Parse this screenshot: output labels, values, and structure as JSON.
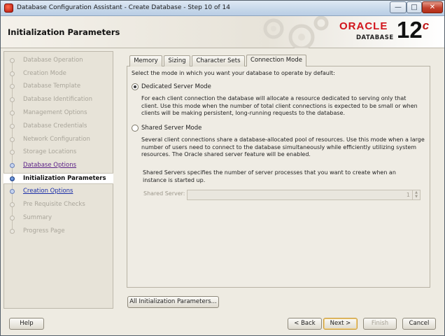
{
  "window": {
    "title": "Database Configuration Assistant - Create Database - Step 10 of 14",
    "min_glyph": "—",
    "max_glyph": "□",
    "close_glyph": "✕"
  },
  "header": {
    "page_title": "Initialization Parameters",
    "brand": "ORACLE",
    "brand_sub": "DATABASE",
    "version": "12",
    "version_sup": "c",
    "accent": "#d2131a"
  },
  "nav": {
    "items": [
      {
        "label": "Database Operation",
        "state": "done"
      },
      {
        "label": "Creation Mode",
        "state": "done"
      },
      {
        "label": "Database Template",
        "state": "done"
      },
      {
        "label": "Database Identification",
        "state": "done"
      },
      {
        "label": "Management Options",
        "state": "done"
      },
      {
        "label": "Database Credentials",
        "state": "done"
      },
      {
        "label": "Network Configuration",
        "state": "done"
      },
      {
        "label": "Storage Locations",
        "state": "done"
      },
      {
        "label": "Database Options",
        "state": "visited"
      },
      {
        "label": "Initialization Parameters",
        "state": "current"
      },
      {
        "label": "Creation Options",
        "state": "link"
      },
      {
        "label": "Pre Requisite Checks",
        "state": "pending"
      },
      {
        "label": "Summary",
        "state": "pending"
      },
      {
        "label": "Progress Page",
        "state": "pending"
      }
    ]
  },
  "tabs": [
    {
      "label": "Memory",
      "active": false
    },
    {
      "label": "Sizing",
      "active": false
    },
    {
      "label": "Character Sets",
      "active": false
    },
    {
      "label": "Connection Mode",
      "active": true
    }
  ],
  "connection_mode": {
    "intro": "Select the mode in which you want your database to operate by default:",
    "dedicated": {
      "label": "Dedicated Server Mode",
      "selected": true,
      "description": "For each client connection the database will allocate a resource dedicated to serving only that client.  Use this mode when the number of total client connections is expected to be small or when clients will be making persistent, long-running requests to the database."
    },
    "shared": {
      "label": "Shared Server Mode",
      "selected": false,
      "description": "Several client connections share a database-allocated pool of resources.  Use this mode when a large number of users need to connect to the database simultaneously while efficiently utilizing system resources.  The Oracle shared server feature will be enabled.",
      "servers_note": "Shared Servers specifies the number of server processes that you want to create when an instance is started up.",
      "servers_label": "Shared Server:",
      "servers_value": "1"
    }
  },
  "buttons": {
    "all_params": "All Initialization Parameters...",
    "help": "Help",
    "back": "< Back",
    "next": "Next >",
    "finish": "Finish",
    "cancel": "Cancel"
  }
}
